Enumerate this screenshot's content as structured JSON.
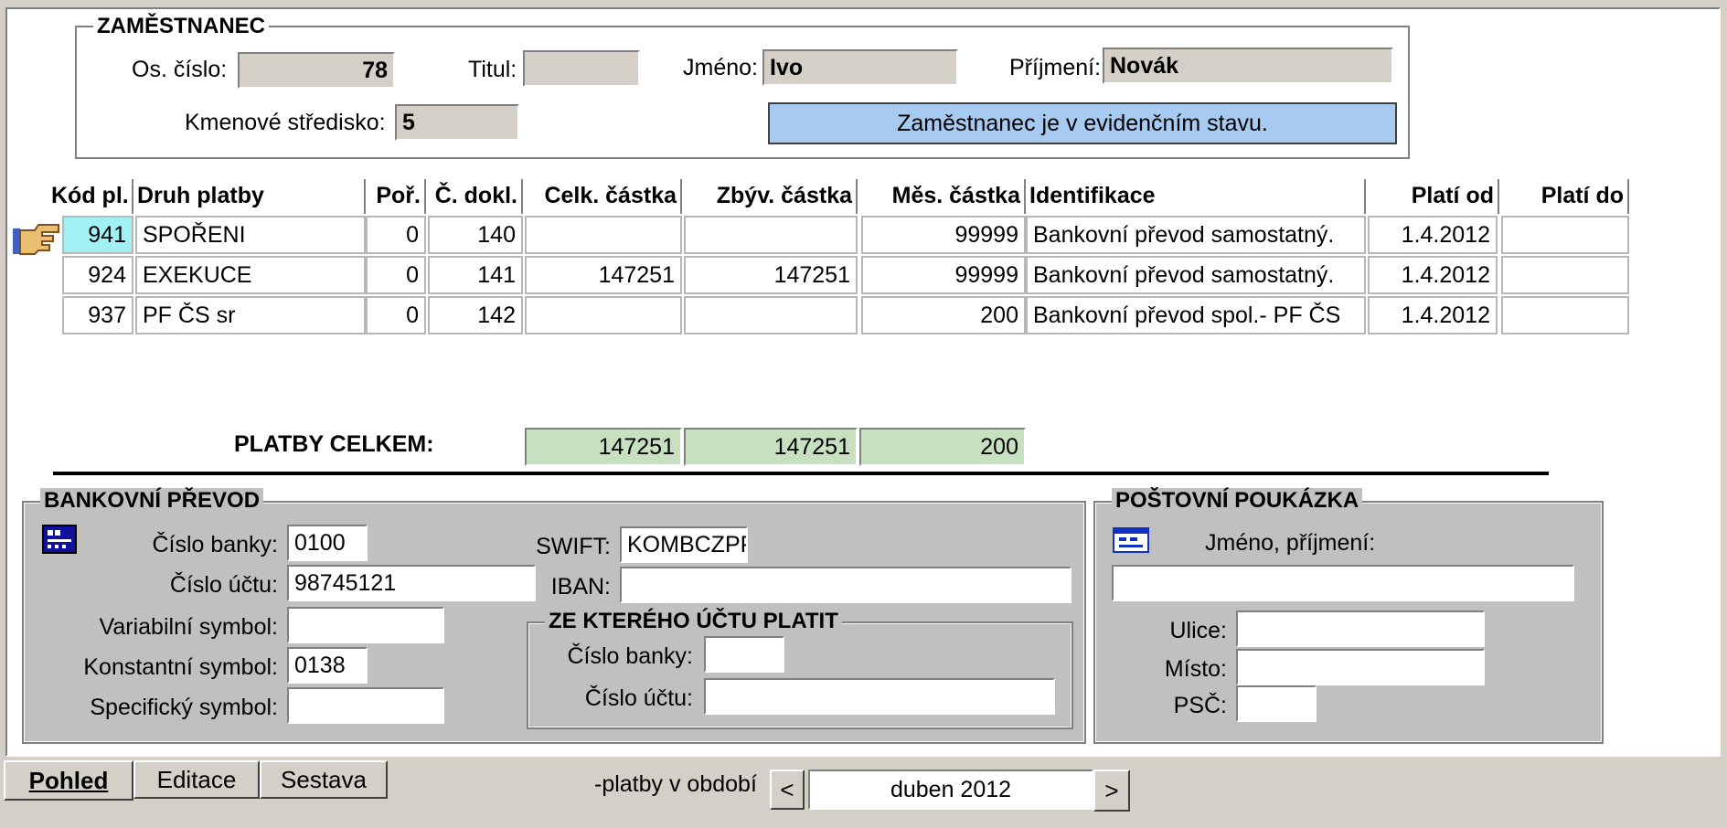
{
  "employee": {
    "title": "ZAMĚSTNANEC",
    "os_cislo_label": "Os. číslo:",
    "os_cislo": "78",
    "titul_label": "Titul:",
    "titul": "",
    "jmeno_label": "Jméno:",
    "jmeno": "Ivo",
    "prijmeni_label": "Příjmení:",
    "prijmeni": "Novák",
    "stredisko_label": "Kmenové středisko:",
    "stredisko": "5",
    "status": "Zaměstnanec je v evidenčním stavu."
  },
  "table": {
    "headers": [
      "Kód pl.",
      "Druh platby",
      "Poř.",
      "Č. dokl.",
      "Celk. částka",
      "Zbýv. částka",
      "Měs. částka",
      "Identifikace",
      "Platí od",
      "Platí do"
    ],
    "rows": [
      {
        "kod": "941",
        "druh": "SPOŘENI",
        "por": "0",
        "dokl": "140",
        "celk": "",
        "zbyv": "",
        "mes": "99999",
        "ident": "Bankovní převod samostatný.",
        "od": "1.4.2012",
        "do": ""
      },
      {
        "kod": "924",
        "druh": "EXEKUCE",
        "por": "0",
        "dokl": "141",
        "celk": "147251",
        "zbyv": "147251",
        "mes": "99999",
        "ident": "Bankovní převod samostatný.",
        "od": "1.4.2012",
        "do": ""
      },
      {
        "kod": "937",
        "druh": "PF ČS sr",
        "por": "0",
        "dokl": "142",
        "celk": "",
        "zbyv": "",
        "mes": "200",
        "ident": "Bankovní převod spol.- PF ČS",
        "od": "1.4.2012",
        "do": ""
      }
    ],
    "selected_row": 0
  },
  "totals": {
    "label": "PLATBY CELKEM:",
    "celk": "147251",
    "zbyv": "147251",
    "mes": "200"
  },
  "bank": {
    "title": "BANKOVNÍ PŘEVOD",
    "cislo_banky_label": "Číslo banky:",
    "cislo_banky": "0100",
    "cislo_uctu_label": "Číslo účtu:",
    "cislo_uctu": "98745121",
    "variabilni_label": "Variabilní symbol:",
    "variabilni": "",
    "konstantni_label": "Konstantní symbol:",
    "konstantni": "0138",
    "specificky_label": "Specifický symbol:",
    "specificky": "",
    "swift_label": "SWIFT:",
    "swift": "KOMBCZPP",
    "iban_label": "IBAN:",
    "iban": "",
    "from_title": "ZE KTERÉHO ÚČTU PLATIT",
    "from_banky_label": "Číslo banky:",
    "from_banky": "",
    "from_uctu_label": "Číslo účtu:",
    "from_uctu": ""
  },
  "postal": {
    "title": "POŠTOVNÍ POUKÁZKA",
    "jmeno_label": "Jméno,  příjmení:",
    "jmeno": "",
    "ulice_label": "Ulice:",
    "ulice": "",
    "misto_label": "Místo:",
    "misto": "",
    "psc_label": "PSČ:",
    "psc": ""
  },
  "tabs": [
    "Pohled",
    "Editace",
    "Sestava"
  ],
  "active_tab": "Pohled",
  "period": {
    "label": "-platby v období",
    "value": "duben 2012",
    "prev": "<",
    "next": ">"
  },
  "icons": {
    "bank": "kb-bank-icon",
    "postal": "postal-order-icon",
    "pointer": "pointing-hand-icon"
  },
  "colors": {
    "status_bg": "#a6caf0",
    "selected_cell": "#a0f0f4",
    "totals_bg": "#c6e0c0",
    "panel_bg": "#c0c0c0"
  }
}
